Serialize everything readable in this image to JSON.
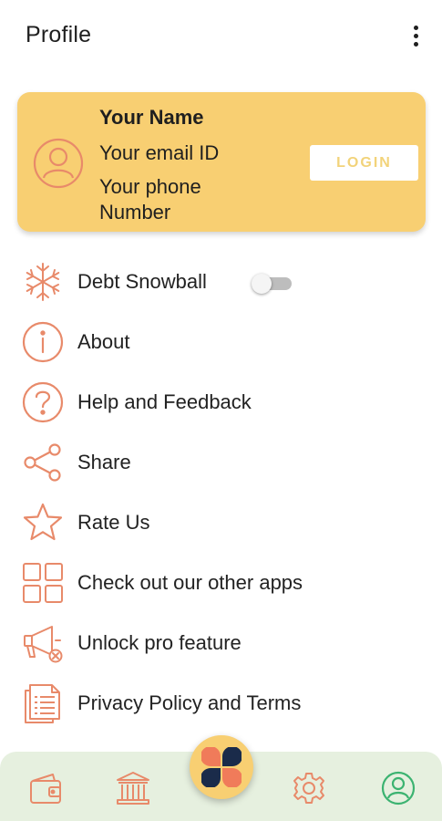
{
  "header": {
    "title": "Profile",
    "menu_icon": "more-vert-icon"
  },
  "profile": {
    "name": "Your Name",
    "email": "Your email ID",
    "phone": "Your phone Number",
    "login_label": "LOGIN",
    "avatar_icon": "user-circle-icon"
  },
  "colors": {
    "accent": "#e88a6a",
    "card": "#f8cf72",
    "bottom_nav": "#e6f0df",
    "profile_nav": "#3cb371",
    "login_text": "#f2d37a"
  },
  "menu": {
    "items": [
      {
        "label": "Debt Snowball",
        "icon": "snowflake-icon",
        "toggle": false
      },
      {
        "label": "About",
        "icon": "info-icon"
      },
      {
        "label": "Help and Feedback",
        "icon": "help-icon"
      },
      {
        "label": "Share",
        "icon": "share-icon"
      },
      {
        "label": "Rate Us",
        "icon": "star-icon"
      },
      {
        "label": "Check out our other apps",
        "icon": "apps-grid-icon"
      },
      {
        "label": "Unlock pro feature",
        "icon": "megaphone-icon"
      },
      {
        "label": "Privacy Policy and Terms",
        "icon": "document-icon"
      }
    ]
  },
  "bottom_nav": {
    "items": [
      {
        "icon": "wallet-icon"
      },
      {
        "icon": "bank-icon"
      },
      {
        "icon": "app-logo-icon"
      },
      {
        "icon": "settings-icon"
      },
      {
        "icon": "profile-icon",
        "active": true
      }
    ]
  }
}
